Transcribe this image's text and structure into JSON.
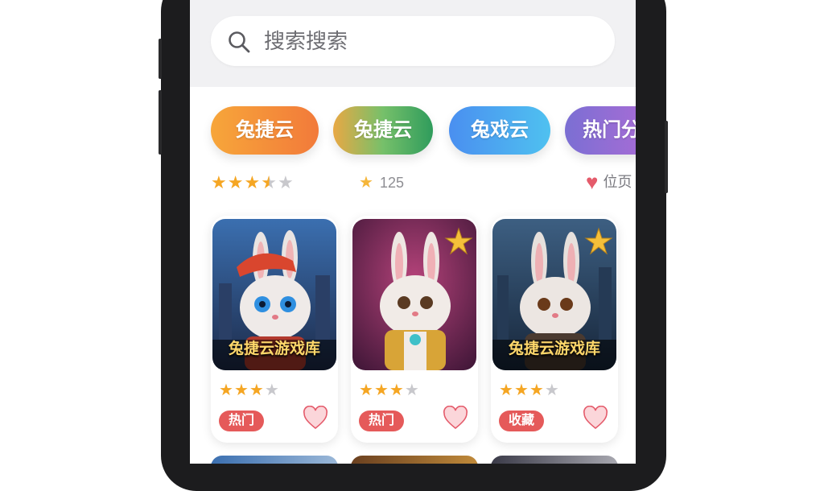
{
  "search": {
    "placeholder": "搜索搜索"
  },
  "categories": [
    {
      "label": "兔捷云"
    },
    {
      "label": "兔捷云"
    },
    {
      "label": "兔戏云"
    },
    {
      "label": "热门分"
    }
  ],
  "stats": {
    "rating": 3.5,
    "count": "125",
    "favorite_label": "位页"
  },
  "cards": [
    {
      "title": "兔捷云游戏库",
      "rating": 3,
      "tag": "热门"
    },
    {
      "title": "",
      "rating": 3,
      "tag": "热门"
    },
    {
      "title": "兔捷云游戏库",
      "rating": 3,
      "tag": "收藏"
    }
  ],
  "colors": {
    "tag": "#e55a5a",
    "star": "#f5a623",
    "heart": "#e45b6b"
  }
}
